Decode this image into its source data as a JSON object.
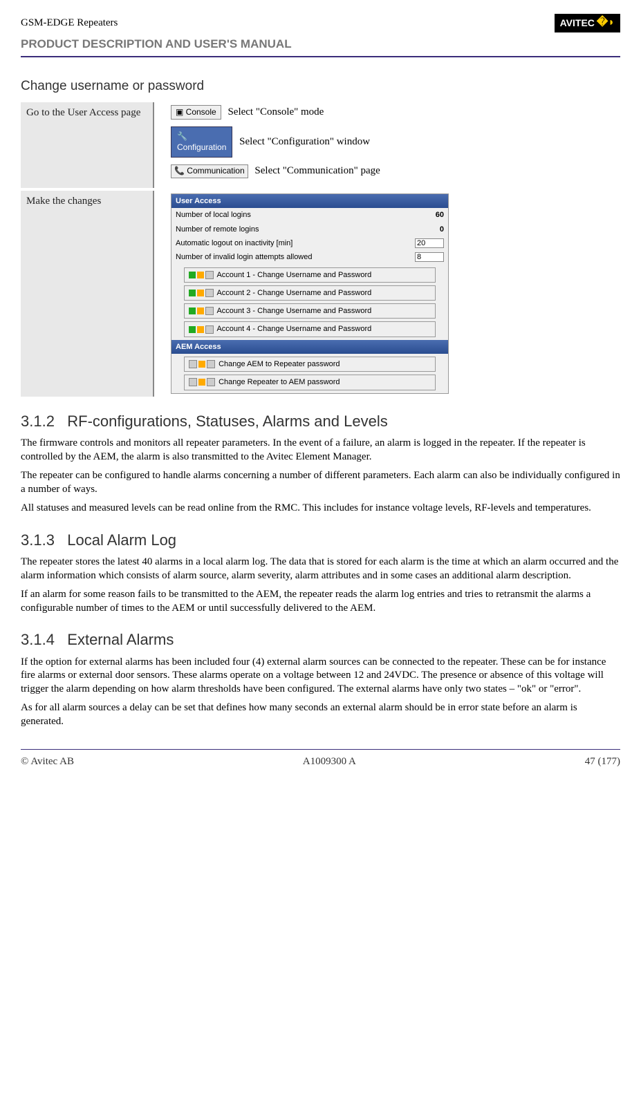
{
  "header": {
    "product": "GSM-EDGE Repeaters",
    "logo": "AVITEC",
    "subtitle": "PRODUCT DESCRIPTION AND USER'S MANUAL"
  },
  "section1": {
    "title": "Change username or password",
    "leftcol1": "Go to the User Access page",
    "console_btn": "Console",
    "console_txt": "Select \"Console\" mode",
    "config_btn": "Configuration",
    "config_txt": "Select \"Configuration\" window",
    "comm_btn": "Communication",
    "comm_txt": "Select \"Communication\" page",
    "leftcol2": "Make the changes",
    "panel": {
      "hdr1": "User Access",
      "r1": "Number of local logins",
      "r1v": "60",
      "r2": "Number of remote logins",
      "r2v": "0",
      "r3": "Automatic logout on inactivity [min]",
      "r3v": "20",
      "r4": "Number of invalid login attempts allowed",
      "r4v": "8",
      "a1": "Account 1 - Change Username and Password",
      "a2": "Account 2 - Change Username and Password",
      "a3": "Account 3 - Change Username and Password",
      "a4": "Account 4 - Change Username and Password",
      "hdr2": "AEM Access",
      "b1": "Change AEM to Repeater password",
      "b2": "Change Repeater to AEM password"
    }
  },
  "s312": {
    "num": "3.1.2",
    "title": "RF-configurations, Statuses, Alarms and Levels",
    "p1": "The firmware controls and monitors all repeater parameters. In the event of a failure, an alarm is logged in the repeater. If the repeater is controlled by the AEM, the alarm is also transmitted to the Avitec Element Manager.",
    "p2": "The repeater can be configured to handle alarms concerning a number of different parameters. Each alarm can also be individually configured in a number of ways.",
    "p3": "All statuses and measured levels can be read online from the RMC. This includes for instance voltage levels, RF-levels and temperatures."
  },
  "s313": {
    "num": "3.1.3",
    "title": "Local Alarm Log",
    "p1": "The repeater stores the latest 40 alarms in a local alarm log. The data that is stored for each alarm is the time at which an alarm occurred and the alarm information which consists of alarm source, alarm severity, alarm attributes and in some cases an additional alarm description.",
    "p2": "If an alarm for some reason fails to be transmitted to the AEM, the repeater reads the alarm log entries and tries to retransmit the alarms a configurable number of times to the AEM or until successfully delivered to the AEM."
  },
  "s314": {
    "num": "3.1.4",
    "title": "External Alarms",
    "p1": "If the option for external alarms has been included four (4) external alarm sources can be connected to the repeater. These can be for instance fire alarms or external door sensors.  These alarms operate on a voltage between 12 and 24VDC. The presence or absence of this voltage will trigger the alarm depending on how alarm thresholds have been configured. The external alarms have only two states – \"ok\" or \"error\".",
    "p2": "As for all alarm sources a delay can be set that defines how many seconds an external alarm should be in error state before an alarm is generated."
  },
  "footer": {
    "left": "© Avitec AB",
    "center": "A1009300 A",
    "right": "47 (177)"
  }
}
